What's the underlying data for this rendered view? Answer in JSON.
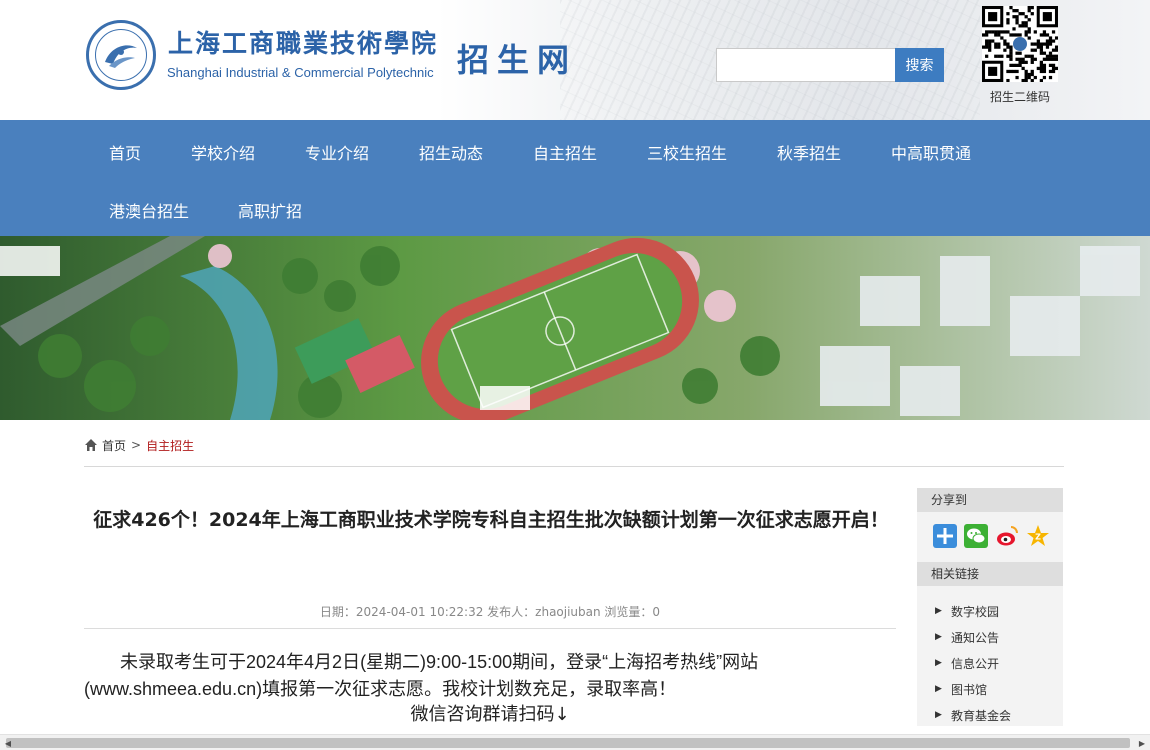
{
  "header": {
    "school_name_cn": "上海工商職業技術學院",
    "school_name_en": "Shanghai Industrial & Commercial Polytechnic",
    "site_name": "招生网",
    "search_placeholder": "",
    "search_button": "搜索",
    "qr_caption": "招生二维码"
  },
  "nav": {
    "items": [
      "首页",
      "学校介绍",
      "专业介绍",
      "招生动态",
      "自主招生",
      "三校生招生",
      "秋季招生",
      "中高职贯通",
      "港澳台招生",
      "高职扩招"
    ]
  },
  "breadcrumb": {
    "home": "首页",
    "separator": ">",
    "current": "自主招生"
  },
  "article": {
    "title": "征求426个！2024年上海工商职业技术学院专科自主招生批次缺额计划第一次征求志愿开启！",
    "meta": "日期：2024-04-01 10:22:32  发布人：zhaojiuban  浏览量：0",
    "paragraph1": "未录取考生可于2024年4月2日(星期二)9:00-15:00期间，登录“上海招考热线”网站(www.shmeea.edu.cn)填报第一次征求志愿。我校计划数充足，录取率高！",
    "paragraph2": "微信咨询群请扫码↓"
  },
  "sidebar": {
    "share_heading": "分享到",
    "share_icons": [
      "plus-share-icon",
      "wechat-icon",
      "weibo-icon",
      "qzone-icon"
    ],
    "links_heading": "相关链接",
    "links": [
      "数字校园",
      "通知公告",
      "信息公开",
      "图书馆",
      "教育基金会"
    ]
  },
  "colors": {
    "brand_blue": "#4a80be",
    "logo_blue": "#2c63a8",
    "breadcrumb_current": "#b11b1b"
  }
}
